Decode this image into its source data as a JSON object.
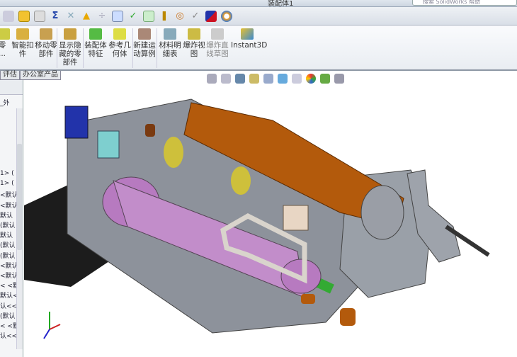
{
  "window": {
    "title": "装配体1",
    "search_placeholder": "搜索 SolidWorks 帮助"
  },
  "ribbon": {
    "items": [
      {
        "label": "零\n..."
      },
      {
        "label": "智能扣\n件"
      },
      {
        "label": "移动零\n部件"
      },
      {
        "label": "显示隐\n藏的零\n部件"
      },
      {
        "label": "装配体\n特征"
      },
      {
        "label": "参考几\n何体"
      },
      {
        "label": "新建运\n动算例"
      },
      {
        "label": "材料明\n细表"
      },
      {
        "label": "爆炸视\n图"
      },
      {
        "label": "爆炸直\n线草图"
      },
      {
        "label": "Instant3D"
      }
    ]
  },
  "tabs": [
    "评估",
    "办公室产品"
  ],
  "tree": {
    "top_item": "_外",
    "items": [
      "1> (",
      "1> (",
      "<默认",
      "<默认",
      "默认",
      "(默认",
      "默认",
      "(默认",
      "(默认",
      "<默认",
      "<默认",
      "< <默",
      "默认<",
      "认<<",
      "(默认",
      "< <默",
      "认<<"
    ]
  },
  "colors": {
    "motor": "#b35a0c",
    "frame": "#8a8f99",
    "belt": "#b77ac0",
    "block_green": "#36b24a",
    "clamp_blue": "#2233aa",
    "yellow": "#d9c82a",
    "accent": "#2d4a8a"
  }
}
